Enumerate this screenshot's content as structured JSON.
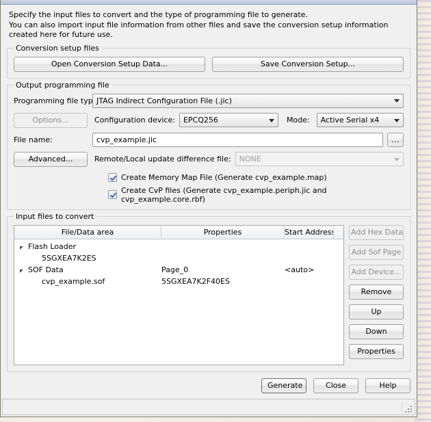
{
  "dialog": {
    "description_line1": "Specify the input files to convert and the type of programming file to generate.",
    "description_line2": "You can also import input file information from other files and save the conversion setup information created here for future use."
  },
  "conversion_setup": {
    "legend": "Conversion setup files",
    "open_button": "Open Conversion Setup Data...",
    "save_button": "Save Conversion Setup..."
  },
  "output_programming_file": {
    "legend": "Output programming file",
    "programming_file_type_label": "Programming file type:",
    "programming_file_type_value": "JTAG Indirect Configuration File (.jic)",
    "options_button": "Options...",
    "configuration_device_label": "Configuration device:",
    "configuration_device_value": "EPCQ256",
    "mode_label": "Mode:",
    "mode_value": "Active Serial x4",
    "file_name_label": "File name:",
    "file_name_value": "cvp_example.jic",
    "browse_button": "...",
    "advanced_button": "Advanced...",
    "remote_local_label": "Remote/Local update difference file:",
    "remote_local_value": "NONE",
    "checkbox_memory_map": "Create Memory Map File (Generate cvp_example.map)",
    "checkbox_cvp": "Create CvP files (Generate cvp_example.periph.jic and cvp_example.core.rbf)"
  },
  "input_files": {
    "legend": "Input files to convert",
    "columns": [
      "File/Data area",
      "Properties",
      "Start Address"
    ],
    "rows": [
      {
        "name": "Flash Loader",
        "properties": "",
        "start_address": "",
        "expandable": true,
        "child": false
      },
      {
        "name": "5SGXEA7K2ES",
        "properties": "",
        "start_address": "",
        "expandable": false,
        "child": true
      },
      {
        "name": "SOF Data",
        "properties": "Page_0",
        "start_address": "<auto>",
        "expandable": true,
        "child": false
      },
      {
        "name": "cvp_example.sof",
        "properties": "5SGXEA7K2F40ES",
        "start_address": "",
        "expandable": false,
        "child": true
      }
    ],
    "side_buttons": [
      {
        "label": "Add Hex Data",
        "disabled": true
      },
      {
        "label": "Add Sof Page",
        "disabled": true
      },
      {
        "label": "Add Device...",
        "disabled": true
      },
      {
        "label": "Remove",
        "disabled": false
      },
      {
        "label": "Up",
        "disabled": false
      },
      {
        "label": "Down",
        "disabled": false
      },
      {
        "label": "Properties",
        "disabled": false
      }
    ]
  },
  "footer": {
    "generate_button": "Generate",
    "close_button": "Close",
    "help_button": "Help"
  }
}
